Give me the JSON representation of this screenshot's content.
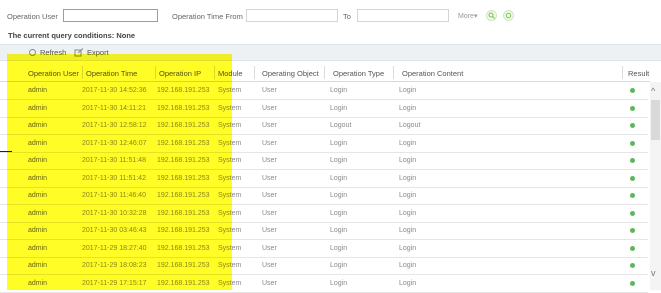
{
  "filters": {
    "operation_user_label": "Operation User",
    "operation_user_value": "",
    "time_from_label": "Operation Time From",
    "time_from_value": "",
    "to_label": "To",
    "to_value": "",
    "more_label": "More▾"
  },
  "conditions": "The current query conditions: None",
  "toolbar": {
    "refresh_label": "Refresh",
    "export_label": "Export"
  },
  "table": {
    "headers": [
      "Operation User",
      "Operation Time",
      "Operation IP",
      "Module",
      "Operating Object",
      "Operation Type",
      "Operation Content",
      "Result"
    ],
    "rows": [
      {
        "user": "admin",
        "time": "2017-11-30 14:52:36",
        "ip": "192.168.191.253",
        "module": "System",
        "object": "User",
        "type": "Login",
        "content": "Login"
      },
      {
        "user": "admin",
        "time": "2017-11-30 14:11:21",
        "ip": "192.168.191.253",
        "module": "System",
        "object": "User",
        "type": "Login",
        "content": "Login"
      },
      {
        "user": "admin",
        "time": "2017-11-30 12:58:12",
        "ip": "192.168.191.253",
        "module": "System",
        "object": "User",
        "type": "Logout",
        "content": "Logout"
      },
      {
        "user": "admin",
        "time": "2017-11-30 12:46:07",
        "ip": "192.168.191.253",
        "module": "System",
        "object": "User",
        "type": "Login",
        "content": "Login"
      },
      {
        "user": "admin",
        "time": "2017-11-30 11:51:48",
        "ip": "192.168.191.253",
        "module": "System",
        "object": "User",
        "type": "Login",
        "content": "Login"
      },
      {
        "user": "admin",
        "time": "2017-11-30 11:51:42",
        "ip": "192.168.191.253",
        "module": "System",
        "object": "User",
        "type": "Login",
        "content": "Login"
      },
      {
        "user": "admin",
        "time": "2017-11-30 11:46:40",
        "ip": "192.168.191.253",
        "module": "System",
        "object": "User",
        "type": "Login",
        "content": "Login"
      },
      {
        "user": "admin",
        "time": "2017-11-30 10:32:28",
        "ip": "192.168.191.253",
        "module": "System",
        "object": "User",
        "type": "Login",
        "content": "Login"
      },
      {
        "user": "admin",
        "time": "2017-11-30 03:46:43",
        "ip": "192.168.191.253",
        "module": "System",
        "object": "User",
        "type": "Login",
        "content": "Login"
      },
      {
        "user": "admin",
        "time": "2017-11-29 18:27:40",
        "ip": "192.168.191.253",
        "module": "System",
        "object": "User",
        "type": "Login",
        "content": "Login"
      },
      {
        "user": "admin",
        "time": "2017-11-29 18:08:23",
        "ip": "192.168.191.253",
        "module": "System",
        "object": "User",
        "type": "Login",
        "content": "Login"
      },
      {
        "user": "admin",
        "time": "2017-11-29 17:15:17",
        "ip": "192.168.191.253",
        "module": "System",
        "object": "User",
        "type": "Login",
        "content": "Login"
      }
    ]
  },
  "colors": {
    "success": "#5cb85c",
    "highlight": "#fffc00"
  }
}
